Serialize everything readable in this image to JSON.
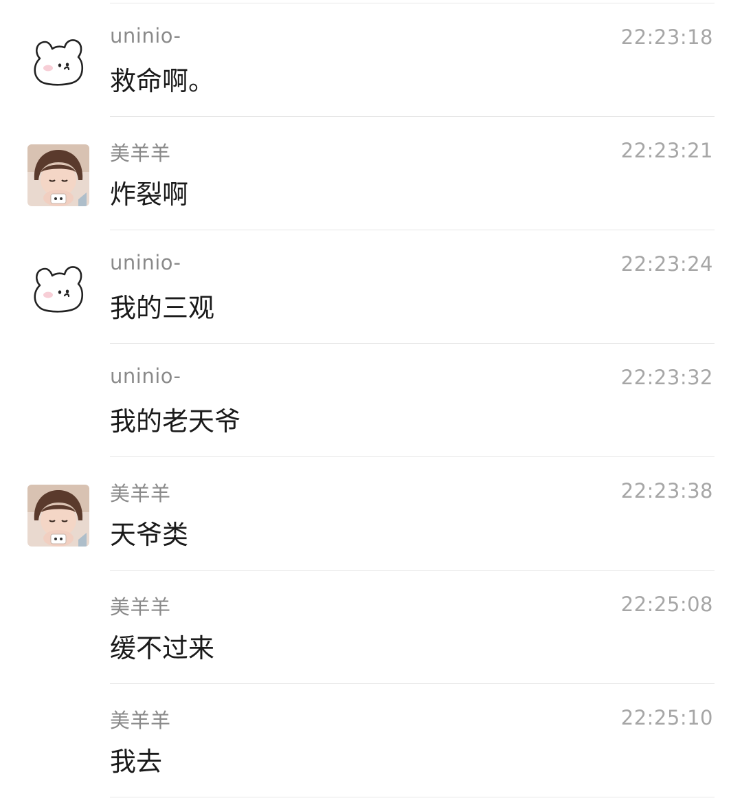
{
  "messages": [
    {
      "sender": "uninio-",
      "time": "22:23:18",
      "text": "救命啊。",
      "avatar": "cartoon-bunny"
    },
    {
      "sender": "美羊羊",
      "time": "22:23:21",
      "text": "炸裂啊",
      "avatar": "photo-child"
    },
    {
      "sender": "uninio-",
      "time": "22:23:24",
      "text": "我的三观",
      "avatar": "cartoon-bunny"
    },
    {
      "sender": "uninio-",
      "time": "22:23:32",
      "text": "我的老天爷",
      "avatar": "none"
    },
    {
      "sender": "美羊羊",
      "time": "22:23:38",
      "text": "天爷类",
      "avatar": "photo-child"
    },
    {
      "sender": "美羊羊",
      "time": "22:25:08",
      "text": "缓不过来",
      "avatar": "none"
    },
    {
      "sender": "美羊羊",
      "time": "22:25:10",
      "text": "我去",
      "avatar": "none"
    }
  ],
  "colors": {
    "sender_text": "#8a8a8a",
    "time_text": "#a6a6a6",
    "message_text": "#1a1a1a",
    "divider": "#e6e6e6"
  }
}
